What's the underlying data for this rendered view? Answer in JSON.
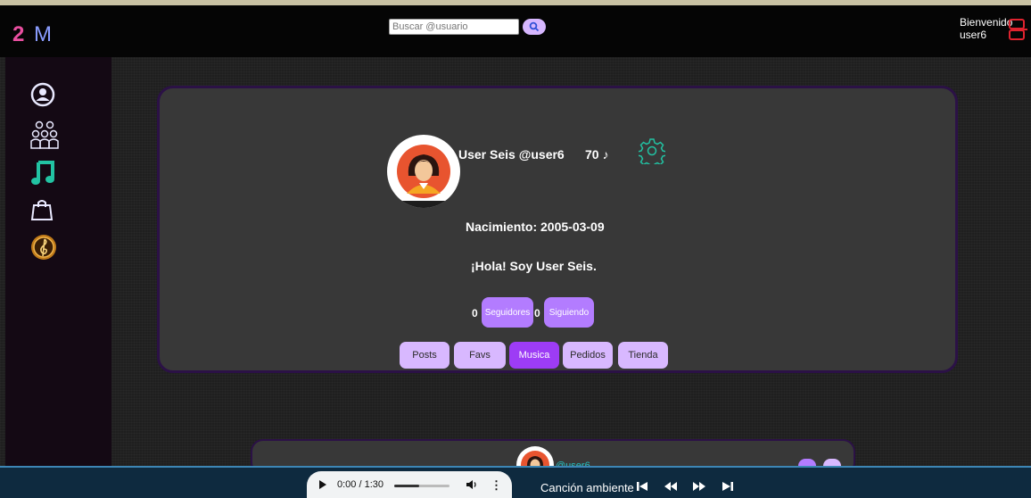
{
  "header": {
    "logo_two": "2",
    "logo_m": "M",
    "search_placeholder": "Buscar @usuario",
    "welcome_line1": "Bienvenido",
    "welcome_line2": "user6"
  },
  "sidebar": {
    "items": [
      {
        "icon": "user-circle-icon"
      },
      {
        "icon": "group-icon"
      },
      {
        "icon": "music-note-icon"
      },
      {
        "icon": "shopping-bag-icon"
      },
      {
        "icon": "treble-clef-medal-icon"
      }
    ]
  },
  "profile": {
    "name": "User Seis @user6",
    "count": "70 ♪",
    "birth": "Nacimiento: 2005-03-09",
    "bio": "¡Hola! Soy User Seis.",
    "followers_count": "0",
    "followers_label": "Seguidores",
    "following_count": "0",
    "following_label": "Siguiendo"
  },
  "tabs": [
    {
      "label": "Posts",
      "active": false
    },
    {
      "label": "Favs",
      "active": false
    },
    {
      "label": "Musica",
      "active": true
    },
    {
      "label": "Pedidos",
      "active": false
    },
    {
      "label": "Tienda",
      "active": false
    }
  ],
  "post_preview": {
    "username": "@user6"
  },
  "player": {
    "time": "0:00 / 1:30",
    "progress": 0,
    "track_name": "Canción ambiente"
  },
  "colors": {
    "accent_purple": "#b37cff",
    "active_tab": "#9d3cf5",
    "teal": "#22c3a3",
    "logout_red": "#e0232f"
  }
}
